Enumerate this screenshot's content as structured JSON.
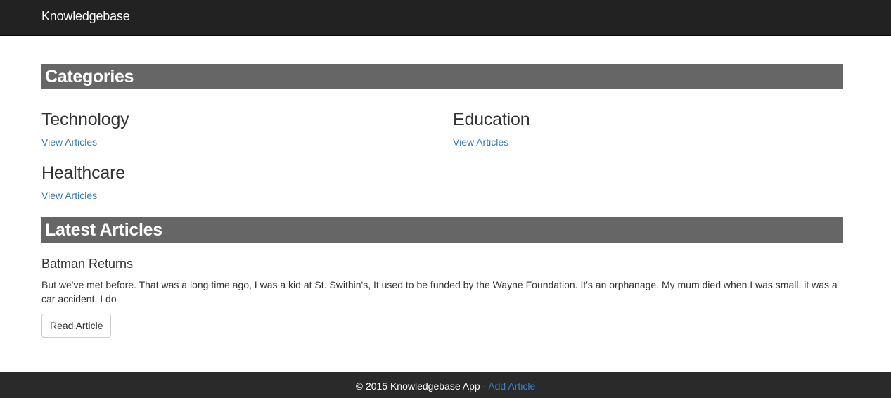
{
  "navbar": {
    "brand": "Knowledgebase"
  },
  "categories": {
    "heading": "Categories",
    "items": [
      {
        "title": "Technology",
        "link": "View Articles"
      },
      {
        "title": "Education",
        "link": "View Articles"
      },
      {
        "title": "Healthcare",
        "link": "View Articles"
      }
    ]
  },
  "latest": {
    "heading": "Latest Articles",
    "articles": [
      {
        "title": "Batman Returns",
        "body": "But we've met before. That was a long time ago, I was a kid at St. Swithin's, It used to be funded by the Wayne Foundation. It's an orphanage. My mum died when I was small, it was a car accident. I do",
        "button": "Read Article"
      }
    ]
  },
  "footer": {
    "text": "© 2015 Knowledgebase App - ",
    "link": "Add Article"
  },
  "colors": {
    "navbar": "#222222",
    "section_header": "#666666",
    "link": "#337ab7",
    "footer": "#2a2a2a"
  }
}
